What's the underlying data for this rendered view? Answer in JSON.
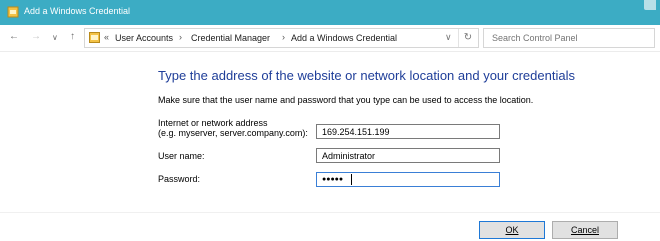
{
  "window": {
    "title": "Add a Windows Credential"
  },
  "nav": {
    "breadcrumb": {
      "overflow": "«",
      "items": [
        "User Accounts",
        "Credential Manager",
        "Add a Windows Credential"
      ]
    },
    "search_placeholder": "Search Control Panel"
  },
  "main": {
    "heading": "Type the address of the website or network location and your credentials",
    "description": "Make sure that the user name and password that you type can be used to access the location.",
    "address": {
      "label_line1": "Internet or network address",
      "label_line2": "(e.g. myserver, server.company.com):",
      "value": "169.254.151.199"
    },
    "username": {
      "label": "User name:",
      "value": "Administrator"
    },
    "password": {
      "label": "Password:",
      "value": "●●●●●"
    }
  },
  "buttons": {
    "ok": "OK",
    "cancel": "Cancel"
  },
  "colors": {
    "titlebar": "#3cacc4",
    "heading": "#1f3e99",
    "focus": "#3a7fd6"
  }
}
